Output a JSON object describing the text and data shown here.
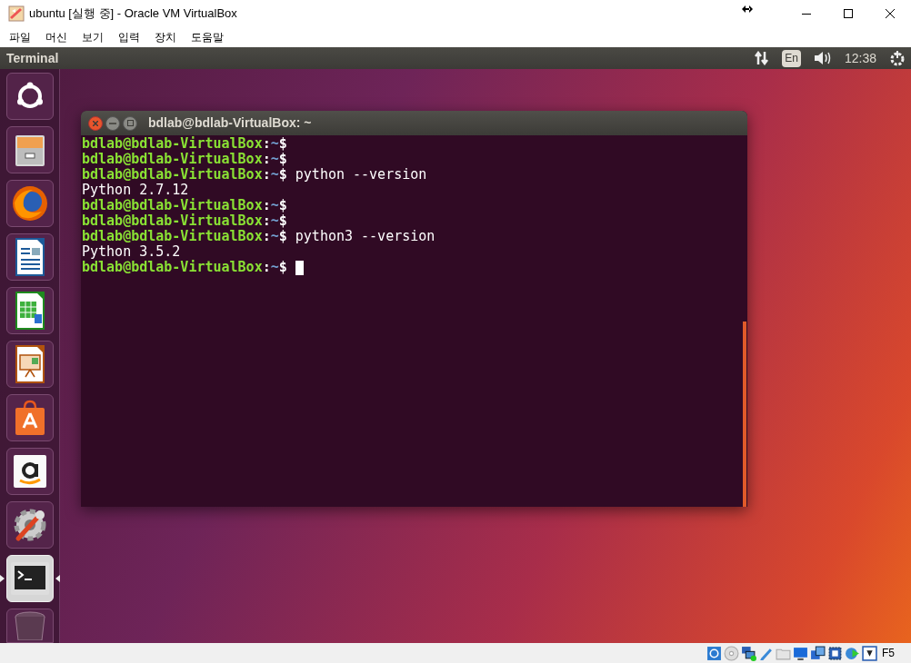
{
  "window": {
    "title": "ubuntu [실행 중] - Oracle VM VirtualBox"
  },
  "menu": [
    "파일",
    "머신",
    "보기",
    "입력",
    "장치",
    "도움말"
  ],
  "top_panel": {
    "app_title": "Terminal",
    "keyboard": "En",
    "clock": "12:38"
  },
  "launcher": [
    {
      "kind": "ubuntu",
      "active": false
    },
    {
      "kind": "files",
      "active": false
    },
    {
      "kind": "firefox",
      "active": false
    },
    {
      "kind": "writer",
      "active": false
    },
    {
      "kind": "calc",
      "active": false
    },
    {
      "kind": "impress",
      "active": false
    },
    {
      "kind": "software",
      "active": false
    },
    {
      "kind": "amazon",
      "active": false
    },
    {
      "kind": "settings",
      "active": false
    },
    {
      "kind": "terminal",
      "active": true
    },
    {
      "kind": "trash",
      "active": false
    }
  ],
  "terminal": {
    "title": "bdlab@bdlab-VirtualBox: ~",
    "lines": [
      {
        "kind": "prompt",
        "host": "bdlab@bdlab-VirtualBox",
        "sep": ":",
        "path": "~",
        "mark": "$"
      },
      {
        "kind": "prompt",
        "host": "bdlab@bdlab-VirtualBox",
        "sep": ":",
        "path": "~",
        "mark": "$"
      },
      {
        "kind": "prompt",
        "host": "bdlab@bdlab-VirtualBox",
        "sep": ":",
        "path": "~",
        "mark": "$",
        "command": "python --version"
      },
      {
        "kind": "output",
        "text": "Python 2.7.12"
      },
      {
        "kind": "prompt",
        "host": "bdlab@bdlab-VirtualBox",
        "sep": ":",
        "path": "~",
        "mark": "$"
      },
      {
        "kind": "prompt",
        "host": "bdlab@bdlab-VirtualBox",
        "sep": ":",
        "path": "~",
        "mark": "$"
      },
      {
        "kind": "prompt",
        "host": "bdlab@bdlab-VirtualBox",
        "sep": ":",
        "path": "~",
        "mark": "$",
        "command": "python3 --version"
      },
      {
        "kind": "output",
        "text": "Python 3.5.2"
      },
      {
        "kind": "prompt",
        "host": "bdlab@bdlab-VirtualBox",
        "sep": ":",
        "path": "~",
        "mark": "$",
        "cursor": true
      }
    ]
  },
  "status_bar": {
    "icons": [
      {
        "kind": "hdd"
      },
      {
        "kind": "optical"
      },
      {
        "kind": "network"
      },
      {
        "kind": "usb"
      },
      {
        "kind": "shared-folder"
      },
      {
        "kind": "display"
      },
      {
        "kind": "capture"
      },
      {
        "kind": "cpu"
      },
      {
        "kind": "mouse"
      },
      {
        "kind": "keyboard"
      }
    ],
    "host_key": "F5"
  }
}
